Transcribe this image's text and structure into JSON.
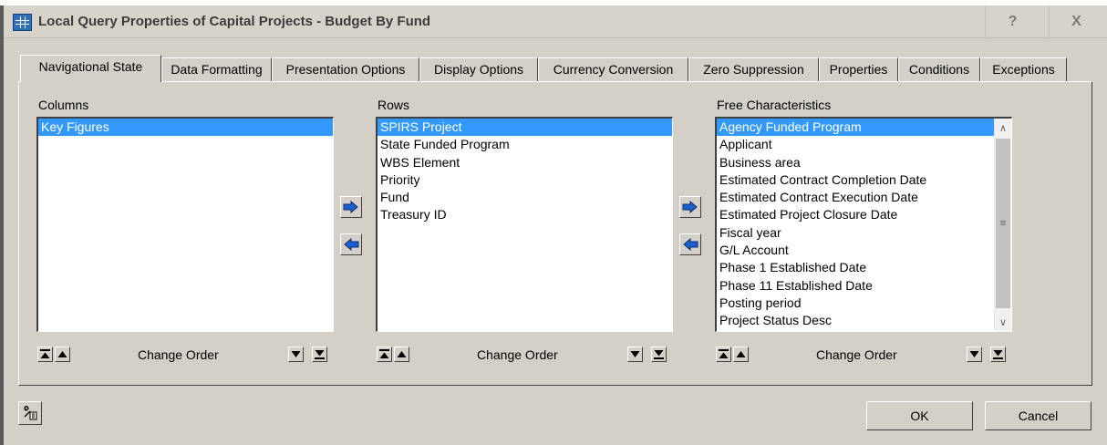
{
  "window": {
    "title": "Local Query Properties of Capital Projects - Budget By Fund",
    "help_label": "?",
    "close_label": "X"
  },
  "tabs": [
    {
      "label": "Navigational State"
    },
    {
      "label": "Data Formatting"
    },
    {
      "label": "Presentation Options"
    },
    {
      "label": "Display Options"
    },
    {
      "label": "Currency Conversion"
    },
    {
      "label": "Zero Suppression"
    },
    {
      "label": "Properties"
    },
    {
      "label": "Conditions"
    },
    {
      "label": "Exceptions"
    }
  ],
  "active_tab": "Navigational State",
  "columns": {
    "label": "Columns",
    "items": [
      {
        "label": "Key Figures",
        "selected": true
      }
    ]
  },
  "rows": {
    "label": "Rows",
    "items": [
      {
        "label": "SPIRS Project",
        "selected": true
      },
      {
        "label": "State Funded Program",
        "selected": false
      },
      {
        "label": "WBS Element",
        "selected": false
      },
      {
        "label": "Priority",
        "selected": false
      },
      {
        "label": "Fund",
        "selected": false
      },
      {
        "label": "Treasury ID",
        "selected": false
      }
    ]
  },
  "free_characteristics": {
    "label": "Free Characteristics",
    "items": [
      {
        "label": "Agency Funded Program",
        "selected": true
      },
      {
        "label": "Applicant",
        "selected": false
      },
      {
        "label": "Business area",
        "selected": false
      },
      {
        "label": "Estimated Contract Completion Date",
        "selected": false
      },
      {
        "label": "Estimated Contract Execution Date",
        "selected": false
      },
      {
        "label": "Estimated Project Closure Date",
        "selected": false
      },
      {
        "label": "Fiscal year",
        "selected": false
      },
      {
        "label": "G/L Account",
        "selected": false
      },
      {
        "label": "Phase 1 Established Date",
        "selected": false
      },
      {
        "label": "Phase 11 Established Date",
        "selected": false
      },
      {
        "label": "Posting period",
        "selected": false
      },
      {
        "label": "Project Status Desc",
        "selected": false
      }
    ]
  },
  "change_order_label": "Change Order",
  "buttons": {
    "ok": "OK",
    "cancel": "Cancel"
  },
  "icons": {
    "title": "grid-table-icon",
    "move_right": "arrow-right-icon",
    "move_left": "arrow-left-icon",
    "move_top": "move-to-top-icon",
    "move_up": "move-up-icon",
    "move_down": "move-down-icon",
    "move_bottom": "move-to-bottom-icon",
    "tool": "wrench-tool-icon"
  },
  "colors": {
    "selection": "#3399ff",
    "arrow": "#1a5fd0",
    "dialog_bg": "#d4d0c8"
  }
}
